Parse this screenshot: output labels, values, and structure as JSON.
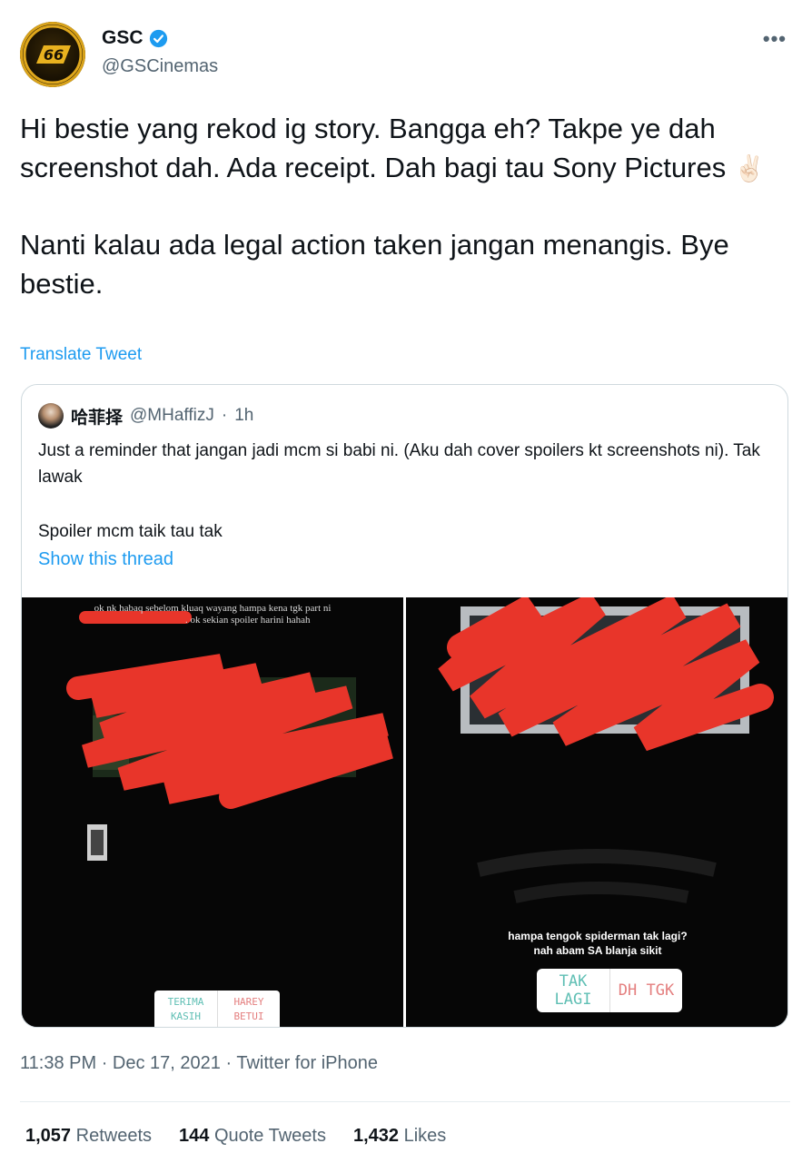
{
  "author": {
    "name": "GSC",
    "handle": "@GSCinemas",
    "verified": true
  },
  "more_icon": "more-horizontal-icon",
  "tweet": {
    "paragraphs": [
      "Hi bestie yang rekod ig story. Bangga eh? Takpe ye dah screenshot dah. Ada receipt. Dah bagi tau Sony Pictures",
      "Nanti kalau ada legal action taken jangan menangis. Bye bestie."
    ],
    "emoji": "✌🏻",
    "translate_label": "Translate Tweet"
  },
  "quoted": {
    "name": "哈菲择",
    "handle": "@MHaffizJ",
    "sep": "·",
    "time": "1h",
    "paragraphs": [
      "Just a reminder that jangan jadi mcm si babi ni. (Aku dah cover spoilers kt screenshots ni). Tak lawak",
      "Spoiler mcm taik tau tak"
    ],
    "show_thread": "Show this thread",
    "image_left": {
      "caption_line1": "ok nk habaq sebelom kluaq wayang hampa kena tgk part ni",
      "caption_line2": ". ok sekian spoiler harini hahah",
      "poll": {
        "opt1": "TERIMA KASIH",
        "opt2": "HAREY BETUI"
      }
    },
    "image_right": {
      "caption_line1": "hampa tengok spiderman tak lagi?",
      "caption_line2": "nah abam SA blanja sikit",
      "poll": {
        "opt1": "TAK LAGI",
        "opt2": "DH TGK"
      }
    }
  },
  "meta": {
    "time": "11:38 PM",
    "date": "Dec 17, 2021",
    "source": "Twitter for iPhone",
    "sep": "·"
  },
  "stats": {
    "retweets_count": "1,057",
    "retweets_label": "Retweets",
    "quotes_count": "144",
    "quotes_label": "Quote Tweets",
    "likes_count": "1,432",
    "likes_label": "Likes"
  },
  "colors": {
    "link": "#1d9bf0",
    "secondary": "#536471",
    "scribble": "#e8352a",
    "gsc_gold": "#d8a21a"
  }
}
